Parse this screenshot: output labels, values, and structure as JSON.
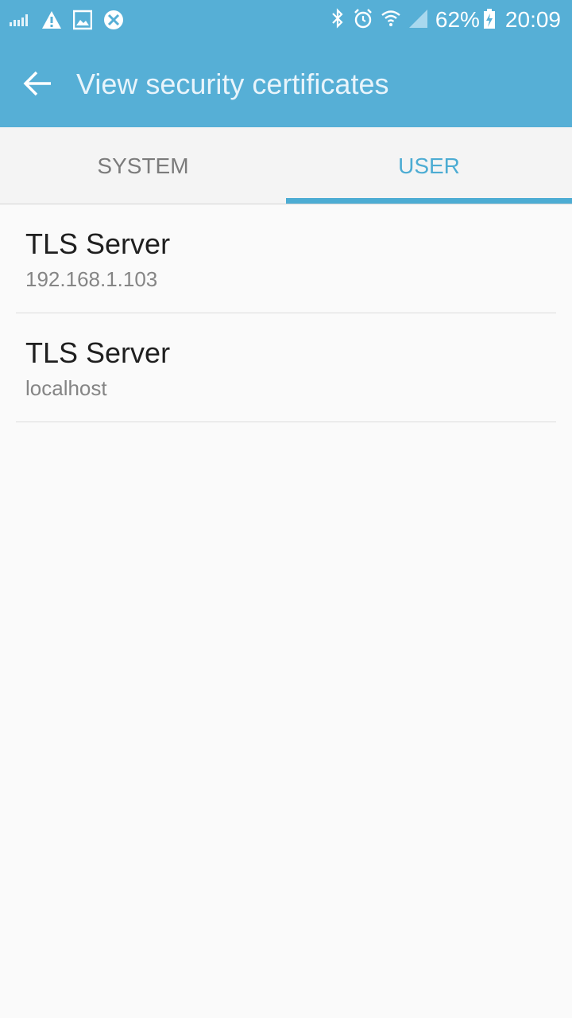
{
  "status_bar": {
    "battery": "62%",
    "time": "20:09",
    "left_icons": [
      "signal-bars-icon",
      "warning-icon",
      "image-icon",
      "blocked-icon"
    ],
    "right_icons": [
      "bluetooth-icon",
      "alarm-icon",
      "wifi-icon",
      "cell-signal-icon",
      "battery-charging-icon"
    ]
  },
  "app_bar": {
    "title": "View security certificates",
    "back_icon": "arrow-left-icon"
  },
  "tabs": [
    {
      "label": "SYSTEM",
      "selected": false
    },
    {
      "label": "USER",
      "selected": true
    }
  ],
  "certificates": [
    {
      "name": "TLS Server",
      "host": "192.168.1.103"
    },
    {
      "name": "TLS Server",
      "host": "localhost"
    }
  ],
  "colors": {
    "primary": "#56afd6",
    "accent": "#4cacd3",
    "background": "#fafafa"
  }
}
